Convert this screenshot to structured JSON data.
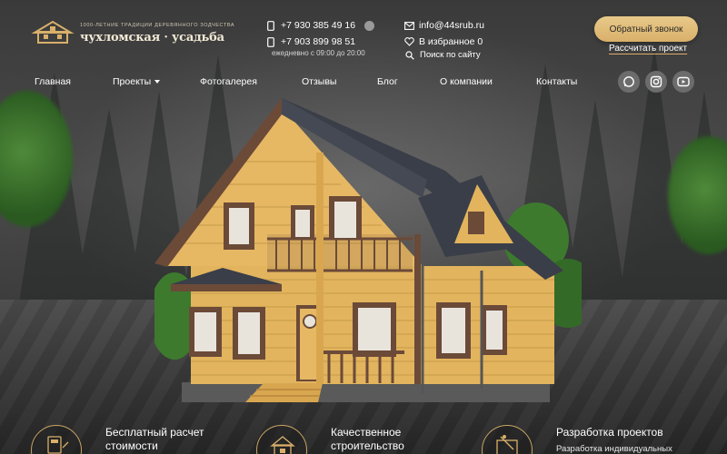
{
  "brand": {
    "tagline": "1000-ЛЕТНИЕ ТРАДИЦИИ ДЕРЕВЯННОГО ЗОДЧЕСТВА",
    "name": "чухломская · усадьба"
  },
  "contacts": {
    "phone1": "+7 930 385 49 16",
    "phone2": "+7 903 899 98 51",
    "hours": "ежедневно с 09:00 до 20:00",
    "email": "info@44srub.ru",
    "favorites": "В избранное 0",
    "search": "Поиск по сайту"
  },
  "actions": {
    "callback": "Обратный звонок",
    "calculate": "Рассчитать проект"
  },
  "nav": {
    "items": [
      "Главная",
      "Проекты",
      "Фотогалерея",
      "Отзывы",
      "Блог",
      "О компании",
      "Контакты"
    ]
  },
  "social": [
    "whatsapp-icon",
    "instagram-icon",
    "youtube-icon"
  ],
  "features": [
    {
      "title_line1": "Бесплатный расчет",
      "title_line2": "стоимости",
      "subtitle": ""
    },
    {
      "title_line1": "Качественное",
      "title_line2": "строительство",
      "subtitle": ""
    },
    {
      "title_line1": "Разработка проектов",
      "title_line2": "",
      "subtitle": "Разработка индивидуальных"
    }
  ],
  "colors": {
    "accent": "#d9b06a",
    "wood": "#e0b25c",
    "roof": "#3a3e48",
    "trim": "#6b4a38"
  }
}
